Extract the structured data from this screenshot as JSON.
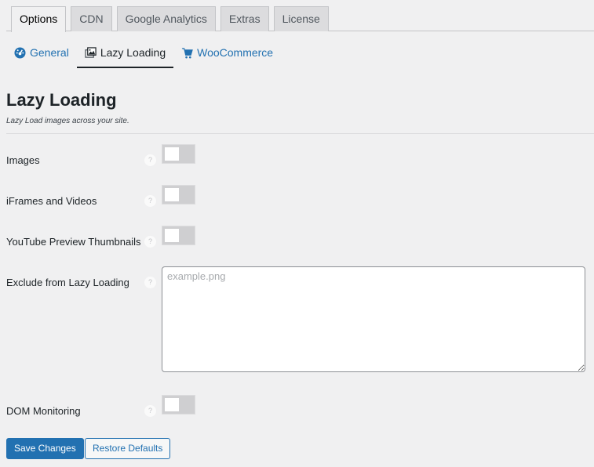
{
  "tabs": [
    {
      "label": "Options",
      "active": true
    },
    {
      "label": "CDN",
      "active": false
    },
    {
      "label": "Google Analytics",
      "active": false
    },
    {
      "label": "Extras",
      "active": false
    },
    {
      "label": "License",
      "active": false
    }
  ],
  "subnav": [
    {
      "label": "General",
      "icon": "dashboard-icon",
      "active": false
    },
    {
      "label": "Lazy Loading",
      "icon": "images-icon",
      "active": true
    },
    {
      "label": "WooCommerce",
      "icon": "cart-icon",
      "active": false
    }
  ],
  "section": {
    "title": "Lazy Loading",
    "description": "Lazy Load images across your site."
  },
  "settings": {
    "images": {
      "label": "Images",
      "enabled": false
    },
    "iframes": {
      "label": "iFrames and Videos",
      "enabled": false
    },
    "youtube": {
      "label": "YouTube Preview Thumbnails",
      "enabled": false
    },
    "exclude": {
      "label": "Exclude from Lazy Loading",
      "value": "",
      "placeholder": "example.png"
    },
    "dom": {
      "label": "DOM Monitoring",
      "enabled": false
    }
  },
  "help_glyph": "?",
  "buttons": {
    "save": "Save Changes",
    "restore": "Restore Defaults"
  },
  "colors": {
    "accent": "#2271b1",
    "background": "#f0f0f1"
  }
}
